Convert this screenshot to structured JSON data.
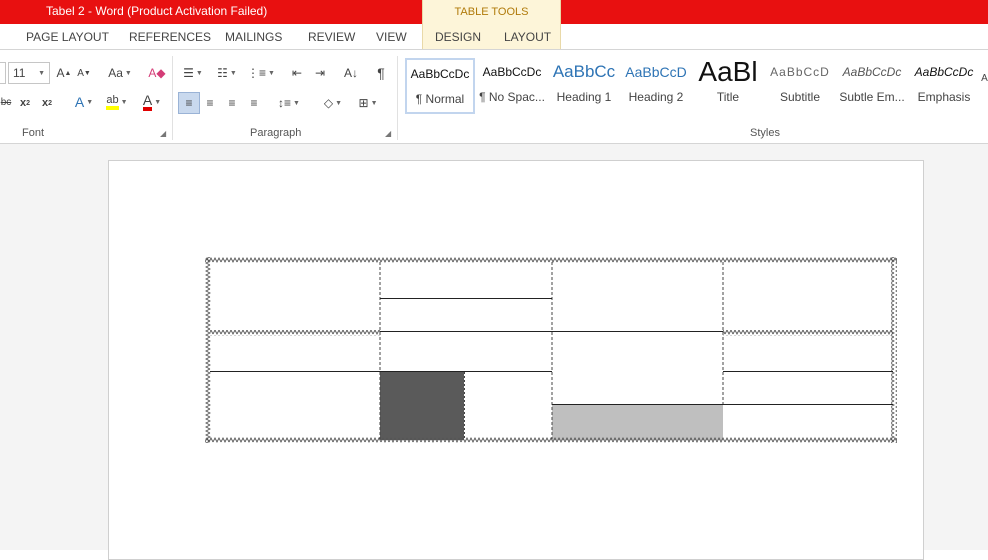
{
  "window": {
    "title": "Tabel 2 -  Word (Product Activation Failed)"
  },
  "context_tab_group": "TABLE TOOLS",
  "tabs": [
    {
      "label": "PAGE LAYOUT"
    },
    {
      "label": "REFERENCES"
    },
    {
      "label": "MAILINGS"
    },
    {
      "label": "REVIEW"
    },
    {
      "label": "VIEW"
    },
    {
      "label": "DESIGN"
    },
    {
      "label": "LAYOUT"
    }
  ],
  "font": {
    "size": "11",
    "group_label": "Font"
  },
  "paragraph": {
    "group_label": "Paragraph"
  },
  "styles": {
    "group_label": "Styles",
    "items": [
      {
        "preview": "AaBbCcDc",
        "name": "¶ Normal"
      },
      {
        "preview": "AaBbCcDc",
        "name": "¶ No Spac..."
      },
      {
        "preview": "AaBbCc",
        "name": "Heading 1"
      },
      {
        "preview": "AaBbCcD",
        "name": "Heading 2"
      },
      {
        "preview": "AaBl",
        "name": "Title"
      },
      {
        "preview": "AaBbCcD",
        "name": "Subtitle"
      },
      {
        "preview": "AaBbCcDc",
        "name": "Subtle Em..."
      },
      {
        "preview": "AaBbCcDc",
        "name": "Emphasis"
      }
    ]
  },
  "colors": {
    "titlebar": "#e81010",
    "highlight": "#ffff00",
    "font_color": "#e00000",
    "dark_shade": "#5a5a5a",
    "light_shade": "#bfbfbf",
    "heading": "#2e74b5"
  }
}
